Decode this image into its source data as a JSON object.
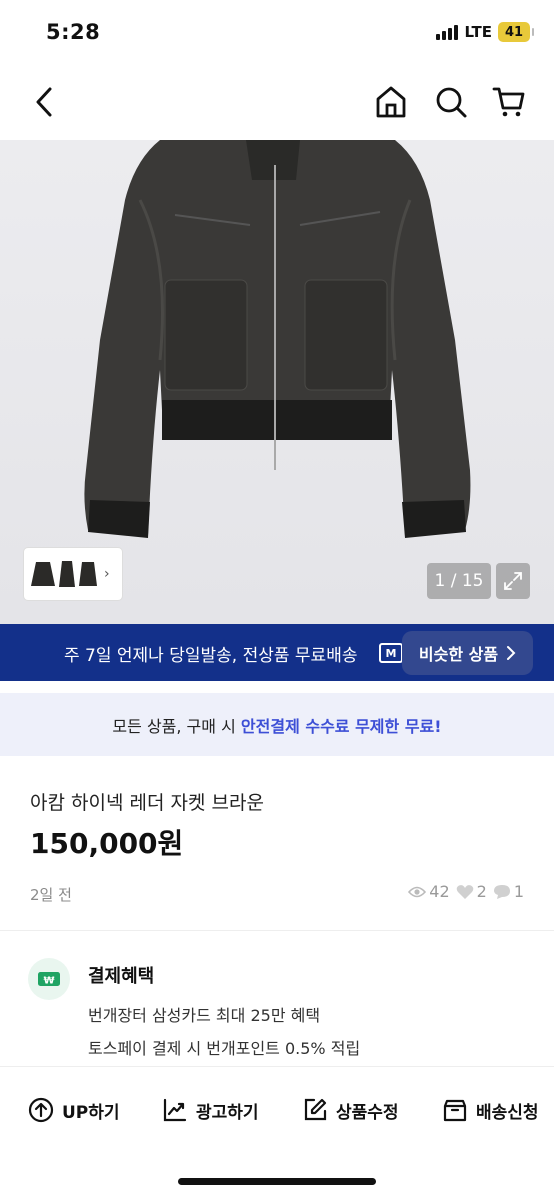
{
  "status_bar": {
    "time": "5:28",
    "network": "LTE",
    "battery": "41"
  },
  "nav": {
    "back_icon": "chevron-left-icon",
    "home_icon": "home-icon",
    "search_icon": "search-icon",
    "cart_icon": "cart-icon"
  },
  "gallery": {
    "counter": "1 / 15"
  },
  "promo": {
    "text": "주 7일 언제나 당일발송, 전상품 무료배송",
    "truck_badge": "M",
    "similar_button": "비슷한 상품"
  },
  "notice": {
    "prefix": "모든 상품, 구매 시 ",
    "highlight": "안전결제 수수료 무제한 무료!"
  },
  "product": {
    "title": "아캄 하이넥 레더 자켓 브라운",
    "price": "150,000원",
    "posted": "2일 전",
    "views": "42",
    "likes": "2",
    "chats": "1"
  },
  "benefits": {
    "title": "결제혜택",
    "line1": "번개장터 삼성카드 최대 25만 혜택",
    "line2": "토스페이 결제 시 번개포인트 0.5% 적립"
  },
  "toolbar": {
    "up": "UP하기",
    "ad": "광고하기",
    "edit": "상품수정",
    "shipping": "배송신청"
  },
  "colors": {
    "banner": "#13308a",
    "accent": "#3d4fd6",
    "benefit_icon": "#1fa463"
  }
}
